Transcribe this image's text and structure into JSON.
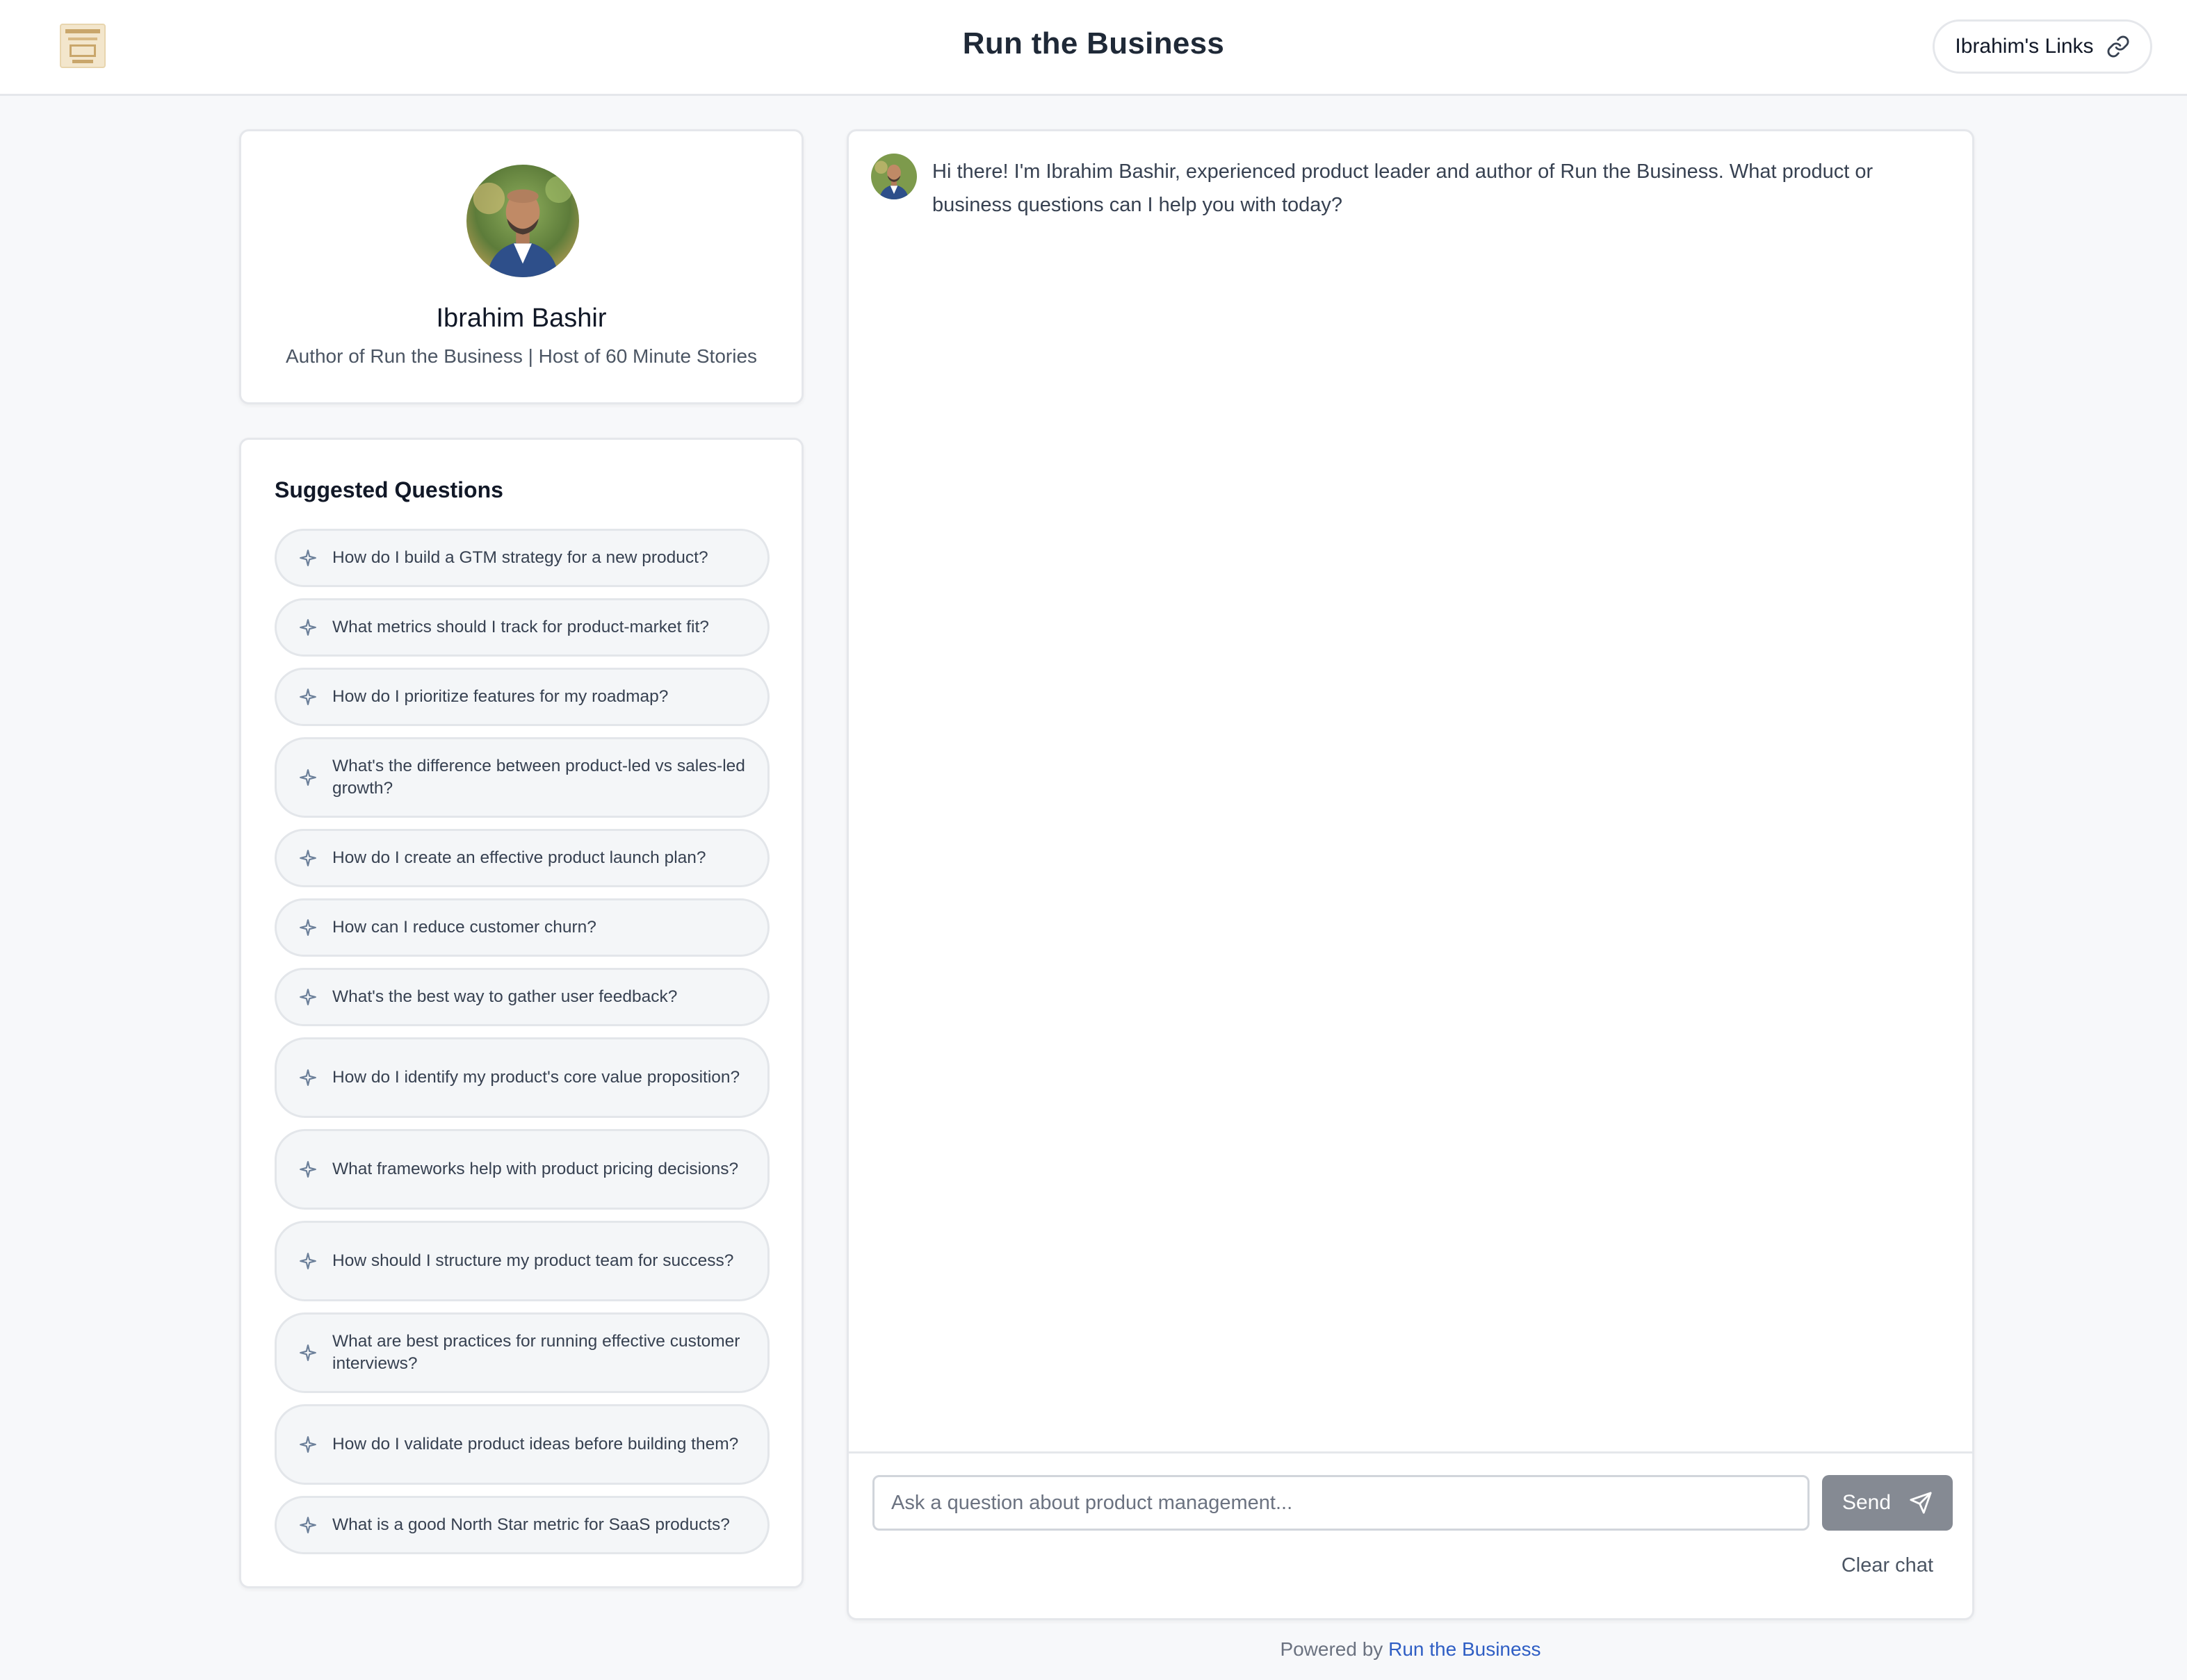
{
  "header": {
    "title": "Run the Business",
    "links_button": "Ibrahim's Links"
  },
  "profile": {
    "name": "Ibrahim Bashir",
    "tagline": "Author of Run the Business | Host of 60 Minute Stories"
  },
  "suggested": {
    "heading": "Suggested Questions",
    "questions": [
      "How do I build a GTM strategy for a new product?",
      "What metrics should I track for product-market fit?",
      "How do I prioritize features for my roadmap?",
      "What's the difference between product-led vs sales-led growth?",
      "How do I create an effective product launch plan?",
      "How can I reduce customer churn?",
      "What's the best way to gather user feedback?",
      "How do I identify my product's core value proposition?",
      "What frameworks help with product pricing decisions?",
      "How should I structure my product team for success?",
      "What are best practices for running effective customer interviews?",
      "How do I validate product ideas before building them?",
      "What is a good North Star metric for SaaS products?"
    ]
  },
  "chat": {
    "welcome_message": "Hi there! I'm Ibrahim Bashir, experienced product leader and author of Run the Business. What product or business questions can I help you with today?",
    "input_placeholder": "Ask a question about product management...",
    "send_label": "Send",
    "clear_label": "Clear chat"
  },
  "footer": {
    "prefix": "Powered by",
    "link_text": "Run the Business"
  },
  "icons": {
    "links": "link-icon",
    "send": "send-icon",
    "question": "sparkle-icon"
  },
  "colors": {
    "send_button": "#858a93",
    "footer_link": "#2f5ec4",
    "background": "#f7f8fa"
  }
}
